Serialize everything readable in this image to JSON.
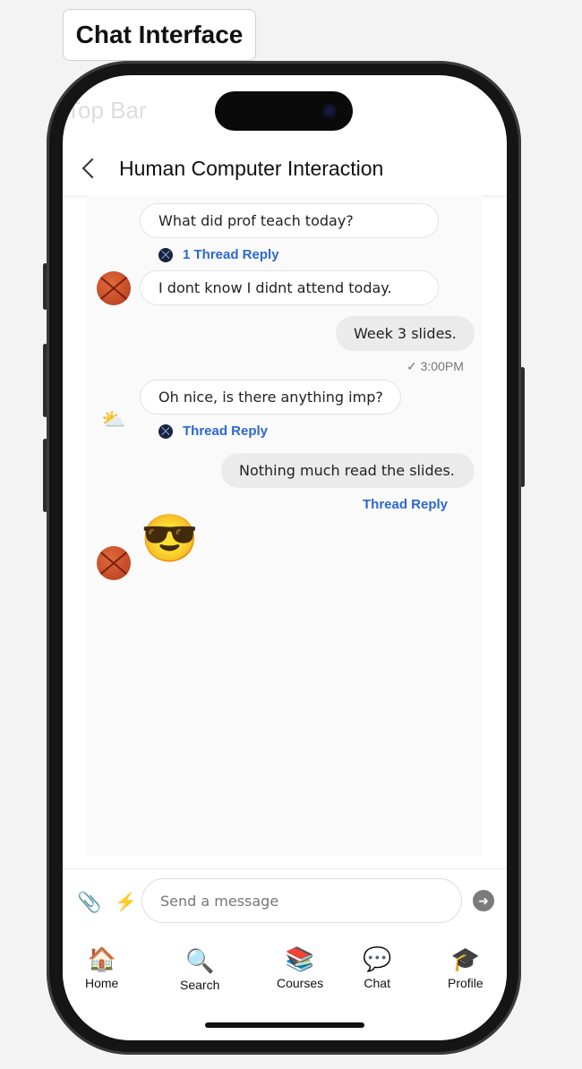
{
  "frame_label": "Chat Interface",
  "ghost_top_label": "Top Bar",
  "header": {
    "title": "Human Computer Interaction"
  },
  "messages": [
    {
      "text": "What did prof teach today?",
      "thread": "1 Thread Reply"
    },
    {
      "text": "I dont know I didnt attend today."
    },
    {
      "text": "Week 3 slides.",
      "time": "3:00PM"
    },
    {
      "text": "Oh nice, is there anything imp?",
      "thread": "Thread Reply"
    },
    {
      "text": "Nothing much read the slides.",
      "thread": "Thread Reply"
    },
    {
      "emoji": "😎"
    }
  ],
  "composer": {
    "placeholder": "Send a message"
  },
  "tabs": [
    {
      "label": "Home",
      "icon": "🏠"
    },
    {
      "label": "Search",
      "icon": "🔍"
    },
    {
      "label": "Courses",
      "icon": "📚"
    },
    {
      "label": "Chat",
      "icon": "💬"
    },
    {
      "label": "Profile",
      "icon": "🎓"
    }
  ],
  "colors": {
    "accent": "#2c68d1",
    "avatar": "#c44a2a"
  }
}
